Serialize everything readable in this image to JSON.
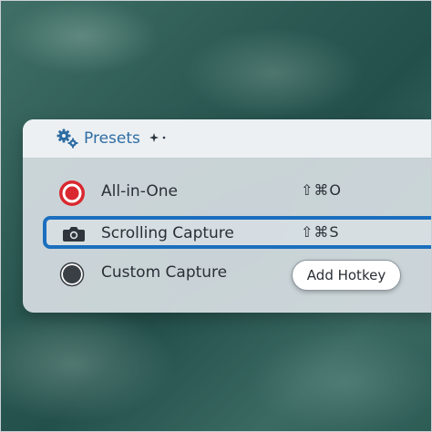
{
  "header": {
    "title": "Presets",
    "icon": "gears-icon",
    "accent_color": "#2e6da3"
  },
  "presets": [
    {
      "label": "All-in-One",
      "shortcut": "⇧⌘O",
      "icon": "record-icon",
      "icon_color": "#d9282f"
    },
    {
      "label": "Scrolling Capture",
      "shortcut": "⇧⌘S",
      "icon": "camera-icon",
      "selected": true
    },
    {
      "label": "Custom Capture",
      "icon": "dot-icon",
      "action_label": "Add Hotkey"
    }
  ],
  "selection_color": "#1b6fbe"
}
